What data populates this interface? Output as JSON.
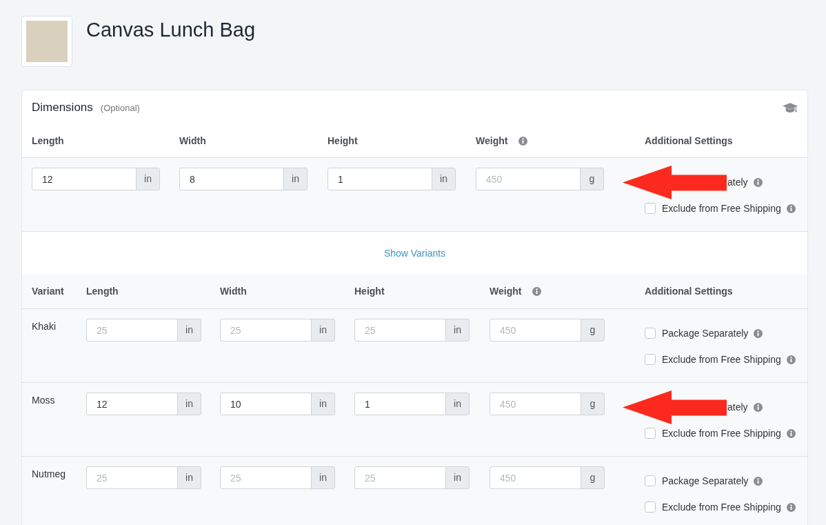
{
  "product": {
    "title": "Canvas Lunch Bag"
  },
  "dimensions": {
    "title": "Dimensions",
    "note": "(Optional)",
    "columns": [
      {
        "label": "Length",
        "info": false
      },
      {
        "label": "Width",
        "info": false
      },
      {
        "label": "Height",
        "info": false
      },
      {
        "label": "Weight",
        "info": true
      },
      {
        "label": "Additional Settings",
        "info": false
      }
    ],
    "fields": [
      {
        "value": "12",
        "unit": "in"
      },
      {
        "value": "8",
        "unit": "in"
      },
      {
        "value": "1",
        "unit": "in"
      },
      {
        "placeholder": "450",
        "unit": "g"
      }
    ],
    "settings": [
      {
        "kind": "arrow-over",
        "label": "ately",
        "info": true
      },
      {
        "kind": "checkbox",
        "label": "Exclude from Free Shipping",
        "checked": false,
        "info": true
      }
    ]
  },
  "show_variants": {
    "label": "Show Variants"
  },
  "variants": {
    "columns": [
      {
        "label": "Variant",
        "info": false
      },
      {
        "label": "Length",
        "info": false
      },
      {
        "label": "Width",
        "info": false
      },
      {
        "label": "Height",
        "info": false
      },
      {
        "label": "Weight",
        "info": true
      },
      {
        "label": "Additional Settings",
        "info": false
      }
    ],
    "rows": [
      {
        "name": "Khaki",
        "fields": [
          {
            "placeholder": "25",
            "unit": "in"
          },
          {
            "placeholder": "25",
            "unit": "in"
          },
          {
            "placeholder": "25",
            "unit": "in"
          },
          {
            "placeholder": "450",
            "unit": "g"
          }
        ],
        "settings": [
          {
            "kind": "checkbox",
            "label": "Package Separately",
            "checked": false,
            "info": true
          },
          {
            "kind": "checkbox",
            "label": "Exclude from Free Shipping",
            "checked": false,
            "info": true
          }
        ]
      },
      {
        "name": "Moss",
        "fields": [
          {
            "value": "12",
            "unit": "in"
          },
          {
            "value": "10",
            "unit": "in"
          },
          {
            "value": "1",
            "unit": "in"
          },
          {
            "placeholder": "450",
            "unit": "g"
          }
        ],
        "settings": [
          {
            "kind": "arrow-over",
            "label": "ately",
            "info": true
          },
          {
            "kind": "checkbox",
            "label": "Exclude from Free Shipping",
            "checked": false,
            "info": true
          }
        ]
      },
      {
        "name": "Nutmeg",
        "fields": [
          {
            "placeholder": "25",
            "unit": "in"
          },
          {
            "placeholder": "25",
            "unit": "in"
          },
          {
            "placeholder": "25",
            "unit": "in"
          },
          {
            "placeholder": "450",
            "unit": "g"
          }
        ],
        "settings": [
          {
            "kind": "checkbox",
            "label": "Package Separately",
            "checked": false,
            "info": true
          },
          {
            "kind": "checkbox",
            "label": "Exclude from Free Shipping",
            "checked": false,
            "info": true
          }
        ]
      }
    ]
  }
}
